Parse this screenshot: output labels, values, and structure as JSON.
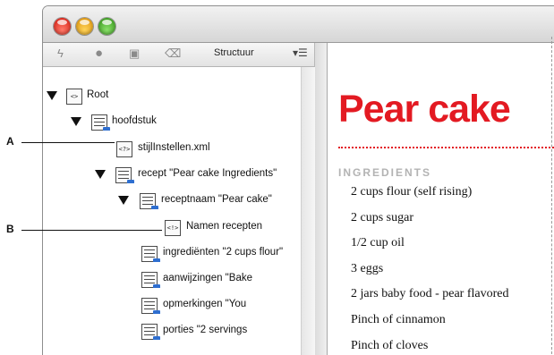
{
  "toolbar": {
    "icons": [
      "lightning-icon",
      "dot-icon",
      "square-icon",
      "trash-icon"
    ],
    "title": "Structuur",
    "menu": "▾☰"
  },
  "tree": {
    "root": "Root",
    "hoofdstuk": "hoofdstuk",
    "stijl": "stijlInstellen.xml",
    "recept": "recept  \"Pear cake Ingredients\"",
    "receptnaam": "receptnaam  \"Pear cake\"",
    "namen": "Namen recepten",
    "ingredienten": "ingrediënten  \"2 cups flour\"",
    "aanwijzingen": "aanwijzingen  \"Bake",
    "opmerkingen": "opmerkingen  \"You",
    "porties": "porties    \"2 servings"
  },
  "document": {
    "title": "Pear cake",
    "section": "INGREDIENTS",
    "items": [
      "2 cups flour (self rising)",
      "2 cups sugar",
      "1/2 cup oil",
      "3 eggs",
      "2 jars baby food - pear flavored",
      "Pinch of cinnamon",
      "Pinch of cloves"
    ]
  },
  "callouts": {
    "a": "A",
    "b": "B"
  },
  "colors": {
    "accent": "#e31a22"
  }
}
